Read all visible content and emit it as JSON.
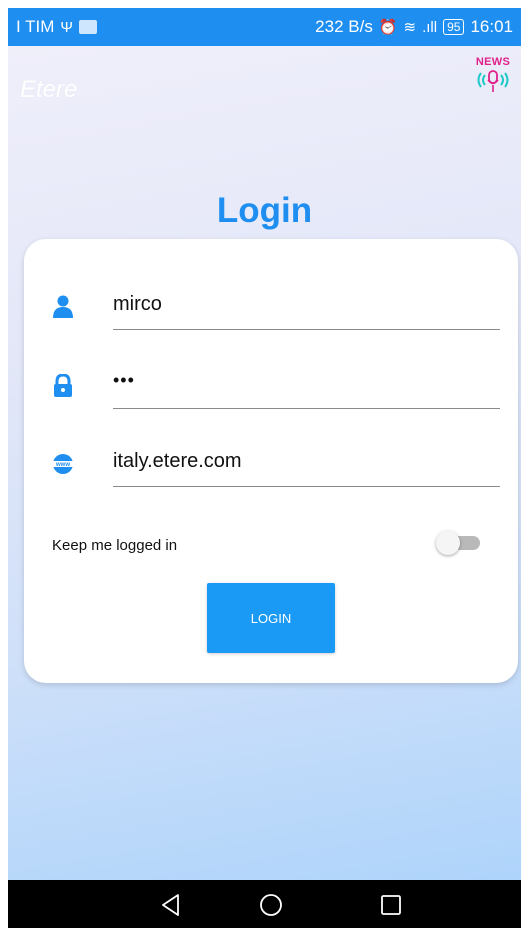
{
  "status_bar": {
    "carrier": "I TIM",
    "net_speed": "232 B/s",
    "battery": "95",
    "time": "16:01",
    "color": "#1e8ef0"
  },
  "app": {
    "title": "Etere",
    "news_label": "NEWS",
    "news_icon": "podcast-microphone-icon"
  },
  "login": {
    "heading": "Login",
    "username": {
      "value": "mirco",
      "icon": "user-icon"
    },
    "password": {
      "value": "•••",
      "icon": "lock-icon"
    },
    "server": {
      "value": "italy.etere.com",
      "icon": "www-globe-icon"
    },
    "keep_logged_label": "Keep me logged in",
    "keep_logged_on": false,
    "button_label": "LOGIN",
    "accent": "#1e8ef0"
  },
  "navbar": {
    "back_icon": "back-triangle-icon",
    "home_icon": "home-circle-icon",
    "recents_icon": "recents-square-icon"
  }
}
